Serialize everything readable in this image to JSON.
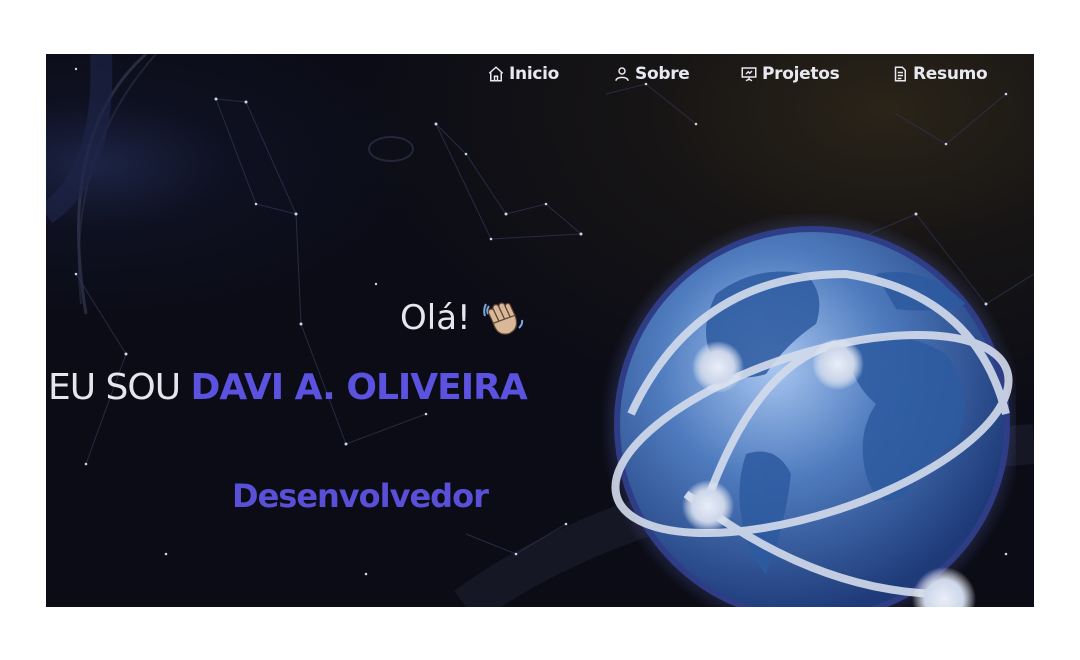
{
  "nav": {
    "items": [
      {
        "label": "Inicio",
        "icon": "home-icon"
      },
      {
        "label": "Sobre",
        "icon": "user-icon"
      },
      {
        "label": "Projetos",
        "icon": "presentation-icon"
      },
      {
        "label": "Resumo",
        "icon": "document-icon"
      }
    ]
  },
  "hero": {
    "greeting": "Olá!",
    "greeting_emoji": "waving-hand-icon",
    "headline_prefix": "EU SOU",
    "headline_name": "DAVI A. OLIVEIRA",
    "role": "Desenvolvedor"
  },
  "colors": {
    "background": "#0b0c16",
    "accent": "#5b53e0",
    "text": "#e6e6ee"
  }
}
